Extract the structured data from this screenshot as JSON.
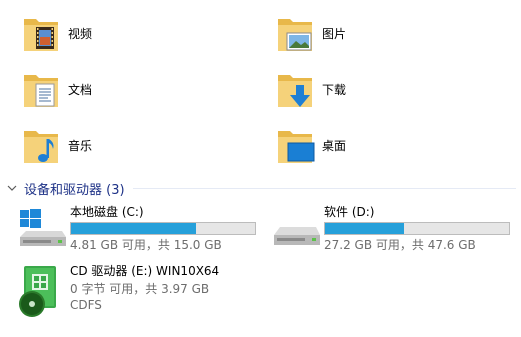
{
  "folders": [
    {
      "label": "视频",
      "icon": "video-folder-icon"
    },
    {
      "label": "图片",
      "icon": "pictures-folder-icon"
    },
    {
      "label": "文档",
      "icon": "documents-folder-icon"
    },
    {
      "label": "下载",
      "icon": "downloads-folder-icon"
    },
    {
      "label": "音乐",
      "icon": "music-folder-icon"
    },
    {
      "label": "桌面",
      "icon": "desktop-folder-icon"
    }
  ],
  "devices_section": {
    "title": "设备和驱动器 (3)"
  },
  "drives": [
    {
      "name": "本地磁盘 (C:)",
      "space": "4.81 GB 可用，共 15.0 GB",
      "used_fraction": 0.68,
      "icon": "system-drive-icon"
    },
    {
      "name": "软件 (D:)",
      "space": "27.2 GB 可用，共 47.6 GB",
      "used_fraction": 0.43,
      "icon": "hard-drive-icon"
    },
    {
      "name": "CD 驱动器 (E:) WIN10X64",
      "space": "0 字节 可用，共 3.97 GB",
      "filesystem": "CDFS",
      "icon": "cd-drive-icon"
    }
  ],
  "colors": {
    "bar_fill": "#26a0da",
    "bar_track": "#e6e6e6",
    "section_title": "#1e3287"
  }
}
